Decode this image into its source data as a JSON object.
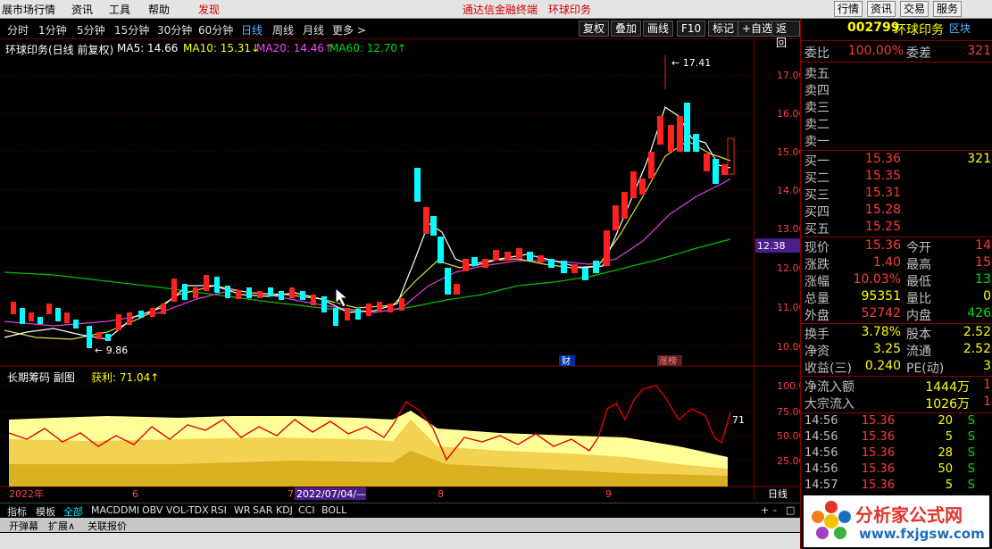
{
  "menubar": {
    "items": [
      "展市场行情",
      "资讯",
      "工具",
      "帮助",
      "发现"
    ],
    "center_note": "通达信金融终端",
    "center_stock": "环球印务",
    "right_buttons": [
      "行情",
      "资讯",
      "交易",
      "服务"
    ]
  },
  "toolbar": {
    "periods": [
      "分时",
      "1分钟",
      "5分钟",
      "15分钟",
      "30分钟",
      "60分钟",
      "日线",
      "周线",
      "月线",
      "更多 >"
    ],
    "selected": "日线",
    "buttons": [
      "复权",
      "叠加",
      "画线",
      "F10",
      "标记",
      "+自选",
      "返回"
    ]
  },
  "main_info": {
    "title": "环球印务(日线 前复权)",
    "ma5": "MA5: 14.66",
    "ma10": "MA10: 15.31↓",
    "ma20": "MA20: 14.46↑",
    "ma60": "MA60: 12.70↑"
  },
  "sub_info": {
    "title": "长期筹码 副图",
    "profit": "获利: 71.04↑"
  },
  "annotations": {
    "high": "17.41",
    "low": "9.86",
    "last_marker": "12.38",
    "fin": "财",
    "news": "涨榜",
    "sub_last": "71"
  },
  "axis": {
    "main_ticks": [
      "17.00",
      "16.00",
      "15.00",
      "14.00",
      "13.00",
      "12.00",
      "11.00",
      "10.00"
    ],
    "sub_ticks": [
      "100.0",
      "75.00",
      "50.00",
      "25.00"
    ],
    "time": [
      "2022年",
      "6",
      "7",
      "2022/07/04/—",
      "8",
      "9"
    ],
    "period_label": "日线"
  },
  "indicator_tabs": {
    "items": [
      "指标",
      "模板",
      "全部",
      "MACD",
      "DMI",
      "OBV",
      "VOL-TDX",
      "RSI",
      "WR",
      "SAR",
      "KDJ",
      "CCI",
      "BOLL"
    ],
    "active": "全部"
  },
  "bottom_bar": {
    "items": [
      "开弹幕",
      "扩展∧",
      "关联报价"
    ]
  },
  "quote_panel": {
    "code": "002799",
    "name": "环球印务",
    "badge": "区块",
    "weibi": {
      "label": "委比",
      "value": "100.00%",
      "label2": "委差",
      "value2": "321"
    },
    "asks": [
      "卖五",
      "卖四",
      "卖三",
      "卖二",
      "卖一"
    ],
    "bids": [
      {
        "label": "买一",
        "price": "15.36",
        "vol": "321"
      },
      {
        "label": "买二",
        "price": "15.35",
        "vol": ""
      },
      {
        "label": "买三",
        "price": "15.31",
        "vol": ""
      },
      {
        "label": "买四",
        "price": "15.28",
        "vol": ""
      },
      {
        "label": "买五",
        "price": "15.25",
        "vol": ""
      }
    ],
    "stats": [
      {
        "l": "现价",
        "v": "15.36",
        "l2": "今开",
        "v2": "14"
      },
      {
        "l": "涨跌",
        "v": "1.40",
        "l2": "最高",
        "v2": "15"
      },
      {
        "l": "涨幅",
        "v": "10.03%",
        "l2": "最低",
        "v2": "13"
      },
      {
        "l": "总量",
        "v": "95351",
        "l2": "量比",
        "v2": "0"
      },
      {
        "l": "外盘",
        "v": "52742",
        "l2": "内盘",
        "v2": "426"
      }
    ],
    "stats2": [
      {
        "l": "换手",
        "v": "3.78%",
        "l2": "股本",
        "v2": "2.52"
      },
      {
        "l": "净资",
        "v": "3.25",
        "l2": "流通",
        "v2": "2.52"
      },
      {
        "l": "收益(三)",
        "v": "0.240",
        "l2": "PE(动)",
        "v2": "3"
      }
    ],
    "flow": [
      {
        "l": "净流入额",
        "v": "1444万",
        "v2": "1"
      },
      {
        "l": "大宗流入",
        "v": "1026万",
        "v2": "1"
      }
    ],
    "ticks": [
      {
        "t": "14:56",
        "p": "15.36",
        "v": "20",
        "d": "S"
      },
      {
        "t": "14:56",
        "p": "15.36",
        "v": "5",
        "d": "S"
      },
      {
        "t": "14:56",
        "p": "15.36",
        "v": "28",
        "d": "S"
      },
      {
        "t": "14:56",
        "p": "15.36",
        "v": "50",
        "d": "S"
      },
      {
        "t": "14:57",
        "p": "15.36",
        "v": "5",
        "d": "S"
      }
    ]
  },
  "logo": {
    "text": "分析家公式网",
    "url": "www.fxjgsw.com"
  }
}
